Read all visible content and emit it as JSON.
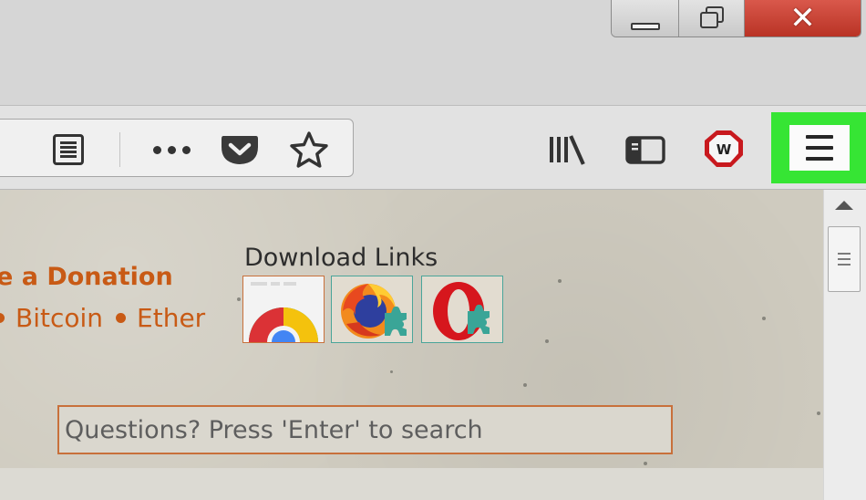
{
  "window": {
    "controls": {
      "minimize": "minimize-icon",
      "maximize": "restore-icon",
      "close": "close-icon",
      "close_color": "#c0392b"
    }
  },
  "toolbar": {
    "url_icons": [
      "reader-view-icon",
      "more-dots-icon",
      "pocket-icon",
      "bookmark-star-icon"
    ],
    "right_icons": [
      "library-icon",
      "sidebar-icon",
      "extension-w-icon",
      "hamburger-menu-icon"
    ],
    "menu_highlight_color": "#36e534",
    "extension_color": "#c8191e"
  },
  "page": {
    "donation_text": "e a Donation",
    "coins": [
      "Bitcoin",
      "Ether"
    ],
    "accent_color": "#c85a15",
    "download_heading": "Download Links",
    "download_tiles": [
      {
        "icon": "chrome-icon"
      },
      {
        "icon": "firefox-icon"
      },
      {
        "icon": "opera-icon"
      }
    ],
    "search": {
      "placeholder": "Questions? Press 'Enter' to search",
      "value": ""
    }
  },
  "scrollbar": {
    "icons": [
      "scroll-up-arrow-icon",
      "scroll-thumb-grip-icon"
    ]
  }
}
